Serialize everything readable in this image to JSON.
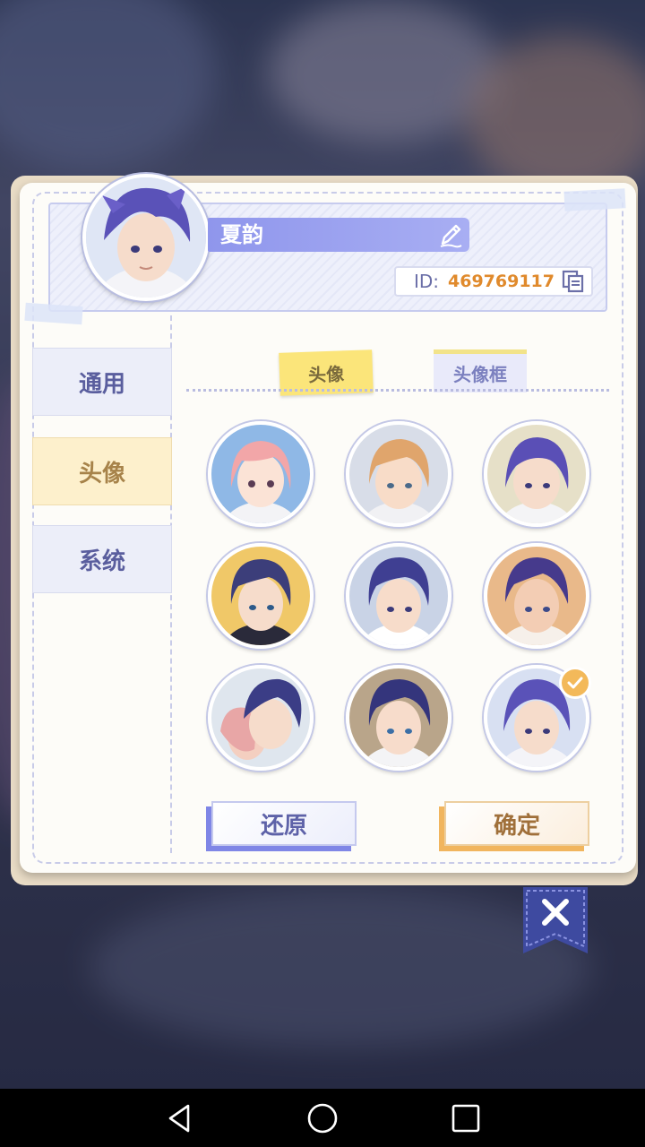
{
  "profile": {
    "name": "夏韵",
    "id_label": "ID:",
    "id_value": "469769117"
  },
  "sidebar": {
    "items": [
      {
        "label": "通用",
        "active": false
      },
      {
        "label": "头像",
        "active": true
      },
      {
        "label": "系统",
        "active": false
      }
    ]
  },
  "tabs": [
    {
      "label": "头像",
      "active": true
    },
    {
      "label": "头像框",
      "active": false
    }
  ],
  "avatars": {
    "selected_index": 8,
    "count": 9
  },
  "buttons": {
    "restore": "还原",
    "confirm": "确定"
  },
  "colors": {
    "accent_purple": "#8f96ec",
    "accent_yellow": "#fbe57a",
    "id_orange": "#e08a2c"
  },
  "icons": [
    "edit-pencil-icon",
    "copy-icon",
    "check-icon",
    "close-icon",
    "nav-back-icon",
    "nav-home-icon",
    "nav-recents-icon"
  ]
}
